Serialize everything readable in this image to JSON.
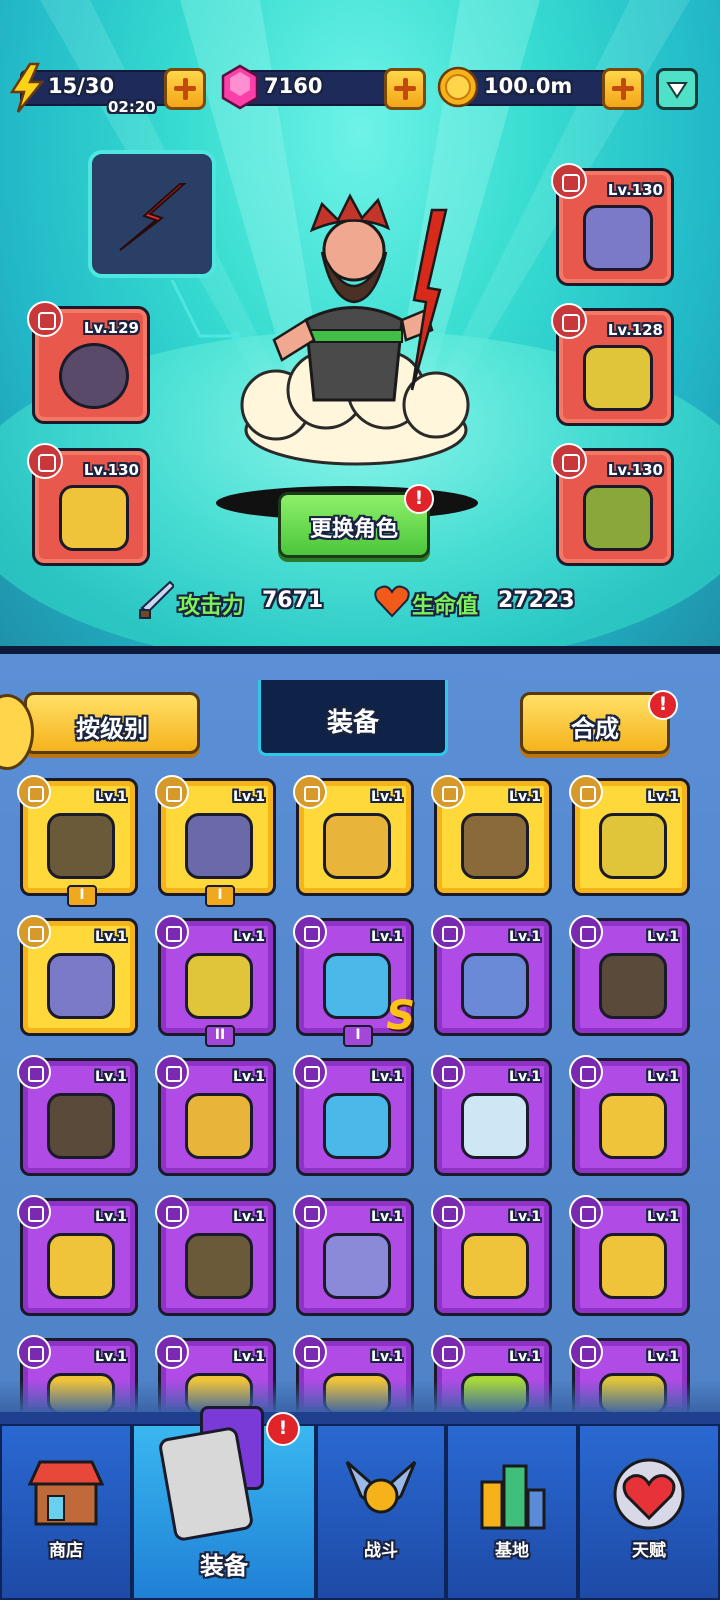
{
  "resources": {
    "energy": "15/30",
    "energy_timer": "02:20",
    "gems": "7160",
    "coins": "100.0m"
  },
  "hero": {
    "change_button": "更换角色",
    "attack_label": "攻击力",
    "attack_value": "7671",
    "hp_label": "生命值",
    "hp_value": "27223"
  },
  "equipped": {
    "necklace": "Lv.129",
    "glove": "Lv.130",
    "armor": "Lv.130",
    "pants": "Lv.128",
    "boots": "Lv.130"
  },
  "panel": {
    "sort_button": "按级别",
    "title": "装备",
    "merge_button": "合成",
    "badge": "!"
  },
  "inventory": [
    {
      "lv": "Lv.1",
      "rarity": "gold",
      "grade": "I",
      "item": "glove-icon",
      "color": "#6a5a3a"
    },
    {
      "lv": "Lv.1",
      "rarity": "gold",
      "grade": "I",
      "item": "armor-icon",
      "color": "#6a6aa8"
    },
    {
      "lv": "Lv.1",
      "rarity": "gold",
      "grade": "",
      "item": "scarf-icon",
      "color": "#e8b43a"
    },
    {
      "lv": "Lv.1",
      "rarity": "gold",
      "grade": "",
      "item": "vest-icon",
      "color": "#8a6a3a"
    },
    {
      "lv": "Lv.1",
      "rarity": "gold",
      "grade": "",
      "item": "shorts-icon",
      "color": "#e0c43a"
    },
    {
      "lv": "Lv.1",
      "rarity": "gold",
      "grade": "",
      "item": "boots-icon",
      "color": "#7a7ac8"
    },
    {
      "lv": "Lv.1",
      "rarity": "purple",
      "grade": "II",
      "item": "shorts-icon",
      "color": "#e0c43a"
    },
    {
      "lv": "Lv.1",
      "rarity": "purple",
      "grade": "I",
      "item": "necklace-icon",
      "color": "#4ab8e8",
      "s": "S"
    },
    {
      "lv": "Lv.1",
      "rarity": "purple",
      "grade": "",
      "item": "necklace-icon",
      "color": "#6a8ad8"
    },
    {
      "lv": "Lv.1",
      "rarity": "purple",
      "grade": "",
      "item": "dogtag-icon",
      "color": "#5a4a3a"
    },
    {
      "lv": "Lv.1",
      "rarity": "purple",
      "grade": "",
      "item": "dogtag-icon",
      "color": "#5a4a3a"
    },
    {
      "lv": "Lv.1",
      "rarity": "purple",
      "grade": "",
      "item": "scarf-icon",
      "color": "#e8b43a"
    },
    {
      "lv": "Lv.1",
      "rarity": "purple",
      "grade": "",
      "item": "necklace-icon",
      "color": "#4ab8e8"
    },
    {
      "lv": "Lv.1",
      "rarity": "purple",
      "grade": "",
      "item": "glove-icon",
      "color": "#cfe6f5"
    },
    {
      "lv": "Lv.1",
      "rarity": "purple",
      "grade": "",
      "item": "glove-icon",
      "color": "#f0c43a"
    },
    {
      "lv": "Lv.1",
      "rarity": "purple",
      "grade": "",
      "item": "glove-icon",
      "color": "#f0c43a"
    },
    {
      "lv": "Lv.1",
      "rarity": "purple",
      "grade": "",
      "item": "glove-icon",
      "color": "#6a5a3a"
    },
    {
      "lv": "Lv.1",
      "rarity": "purple",
      "grade": "",
      "item": "glove-icon",
      "color": "#8a8ad8"
    },
    {
      "lv": "Lv.1",
      "rarity": "purple",
      "grade": "",
      "item": "shirt-icon",
      "color": "#f0c43a"
    },
    {
      "lv": "Lv.1",
      "rarity": "purple",
      "grade": "",
      "item": "shirt-icon",
      "color": "#f0c43a"
    },
    {
      "lv": "Lv.1",
      "rarity": "purple",
      "grade": "",
      "item": "shirt-icon",
      "color": "#f0c43a"
    },
    {
      "lv": "Lv.1",
      "rarity": "purple",
      "grade": "",
      "item": "shirt-icon",
      "color": "#f0c43a"
    },
    {
      "lv": "Lv.1",
      "rarity": "purple",
      "grade": "",
      "item": "shirt-icon",
      "color": "#f0c43a"
    },
    {
      "lv": "Lv.1",
      "rarity": "purple",
      "grade": "",
      "item": "pants-icon",
      "color": "#a8d83a"
    },
    {
      "lv": "Lv.1",
      "rarity": "purple",
      "grade": "",
      "item": "shorts-icon",
      "color": "#e0c43a"
    }
  ],
  "nav": {
    "shop": "商店",
    "equipment": "装备",
    "battle": "战斗",
    "base": "基地",
    "talent": "天赋",
    "badge": "!"
  },
  "colors": {
    "rarity_gold": "#ffd93a",
    "rarity_purple": "#b04be6",
    "equipped_slot": "#e9584c",
    "accent_green": "#5ee05a"
  }
}
